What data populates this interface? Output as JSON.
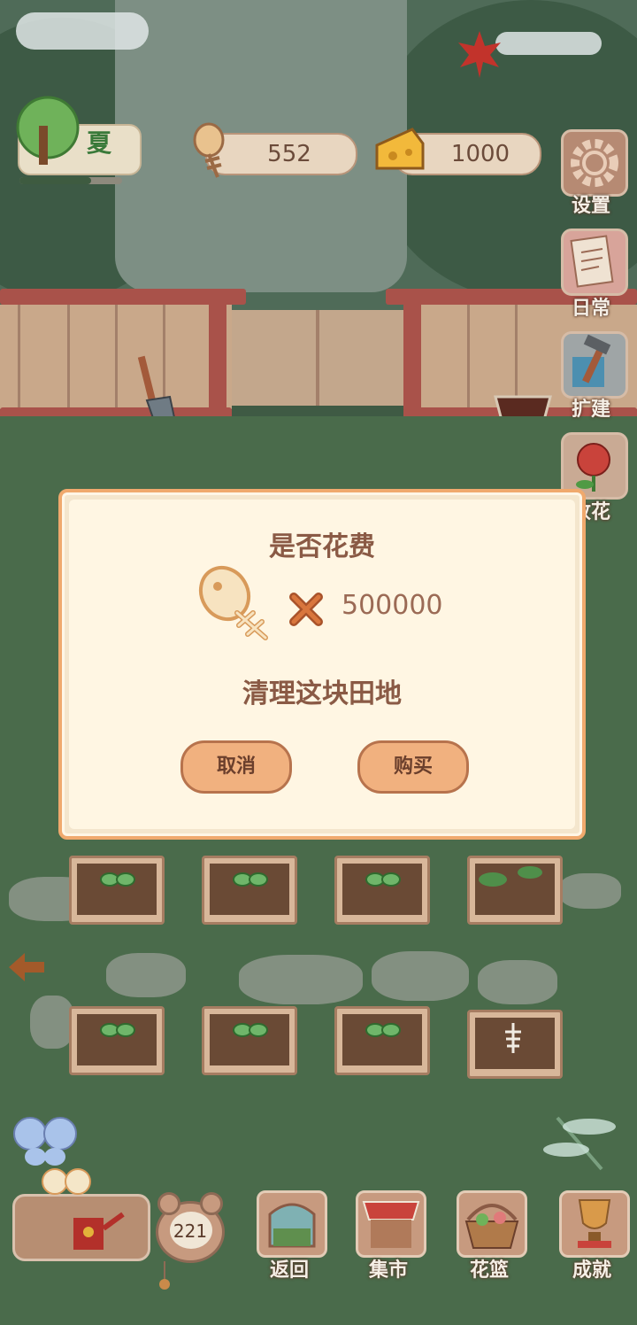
{
  "hud": {
    "season": "夏",
    "season_progress": 0.7,
    "fishbone_count": "552",
    "cheese_count": "1000"
  },
  "side_menu": [
    {
      "label": "设置",
      "icon": "gear-icon"
    },
    {
      "label": "日常",
      "icon": "task-note-icon"
    },
    {
      "label": "扩建",
      "icon": "hammer-icon"
    },
    {
      "label": "收花",
      "icon": "rose-icon"
    }
  ],
  "modal": {
    "title": "是否花费",
    "cost_icon": "fishbone-icon",
    "multiply_icon": "multiply-icon",
    "cost_value": "500000",
    "message": "清理这块田地",
    "cancel_label": "取消",
    "buy_label": "购买"
  },
  "bottom_bar": {
    "clock_value": "221",
    "items": [
      {
        "label": "返回",
        "icon": "window-icon"
      },
      {
        "label": "集市",
        "icon": "market-stall-icon"
      },
      {
        "label": "花篮",
        "icon": "flower-basket-icon"
      },
      {
        "label": "成就",
        "icon": "trophy-icon"
      }
    ]
  },
  "colors": {
    "modal_border": "#f0a96d",
    "modal_bg": "#fff6e3",
    "button_fill": "#f1b17f",
    "text_brown": "#8a5a45"
  }
}
